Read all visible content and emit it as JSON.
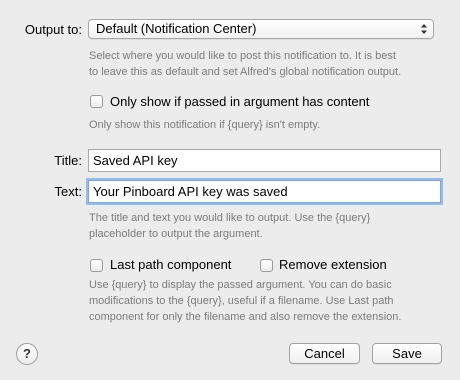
{
  "output": {
    "label": "Output to:",
    "selected": "Default (Notification Center)",
    "help": [
      "Select where you would like to post this notification to. It is best",
      "to leave this as default and set Alfred's global notification output."
    ]
  },
  "only_show": {
    "label": "Only show if passed in argument has content",
    "checked": false,
    "help": "Only show this notification if {query} isn't empty."
  },
  "title_field": {
    "label": "Title:",
    "value": "Saved API key"
  },
  "text_field": {
    "label": "Text:",
    "value": "Your Pinboard API key was saved"
  },
  "fields_help": [
    "The title and text you would like to output. Use the {query}",
    "placeholder to output the argument."
  ],
  "last_path": {
    "label": "Last path component",
    "checked": false
  },
  "remove_ext": {
    "label": "Remove extension",
    "checked": false
  },
  "bottom_help": [
    "Use {query} to display the passed argument. You can do basic",
    "modifications to the {query}, useful if a filename. Use Last path",
    "component for only the filename and also remove the extension."
  ],
  "buttons": {
    "help_glyph": "?",
    "cancel": "Cancel",
    "save": "Save"
  },
  "icons": {
    "select_arrows": "updown-arrows-icon",
    "help": "question-mark-icon"
  },
  "colors": {
    "background": "#ececec",
    "help_text": "#7c7c7c",
    "focus_ring": "#93bcef"
  }
}
